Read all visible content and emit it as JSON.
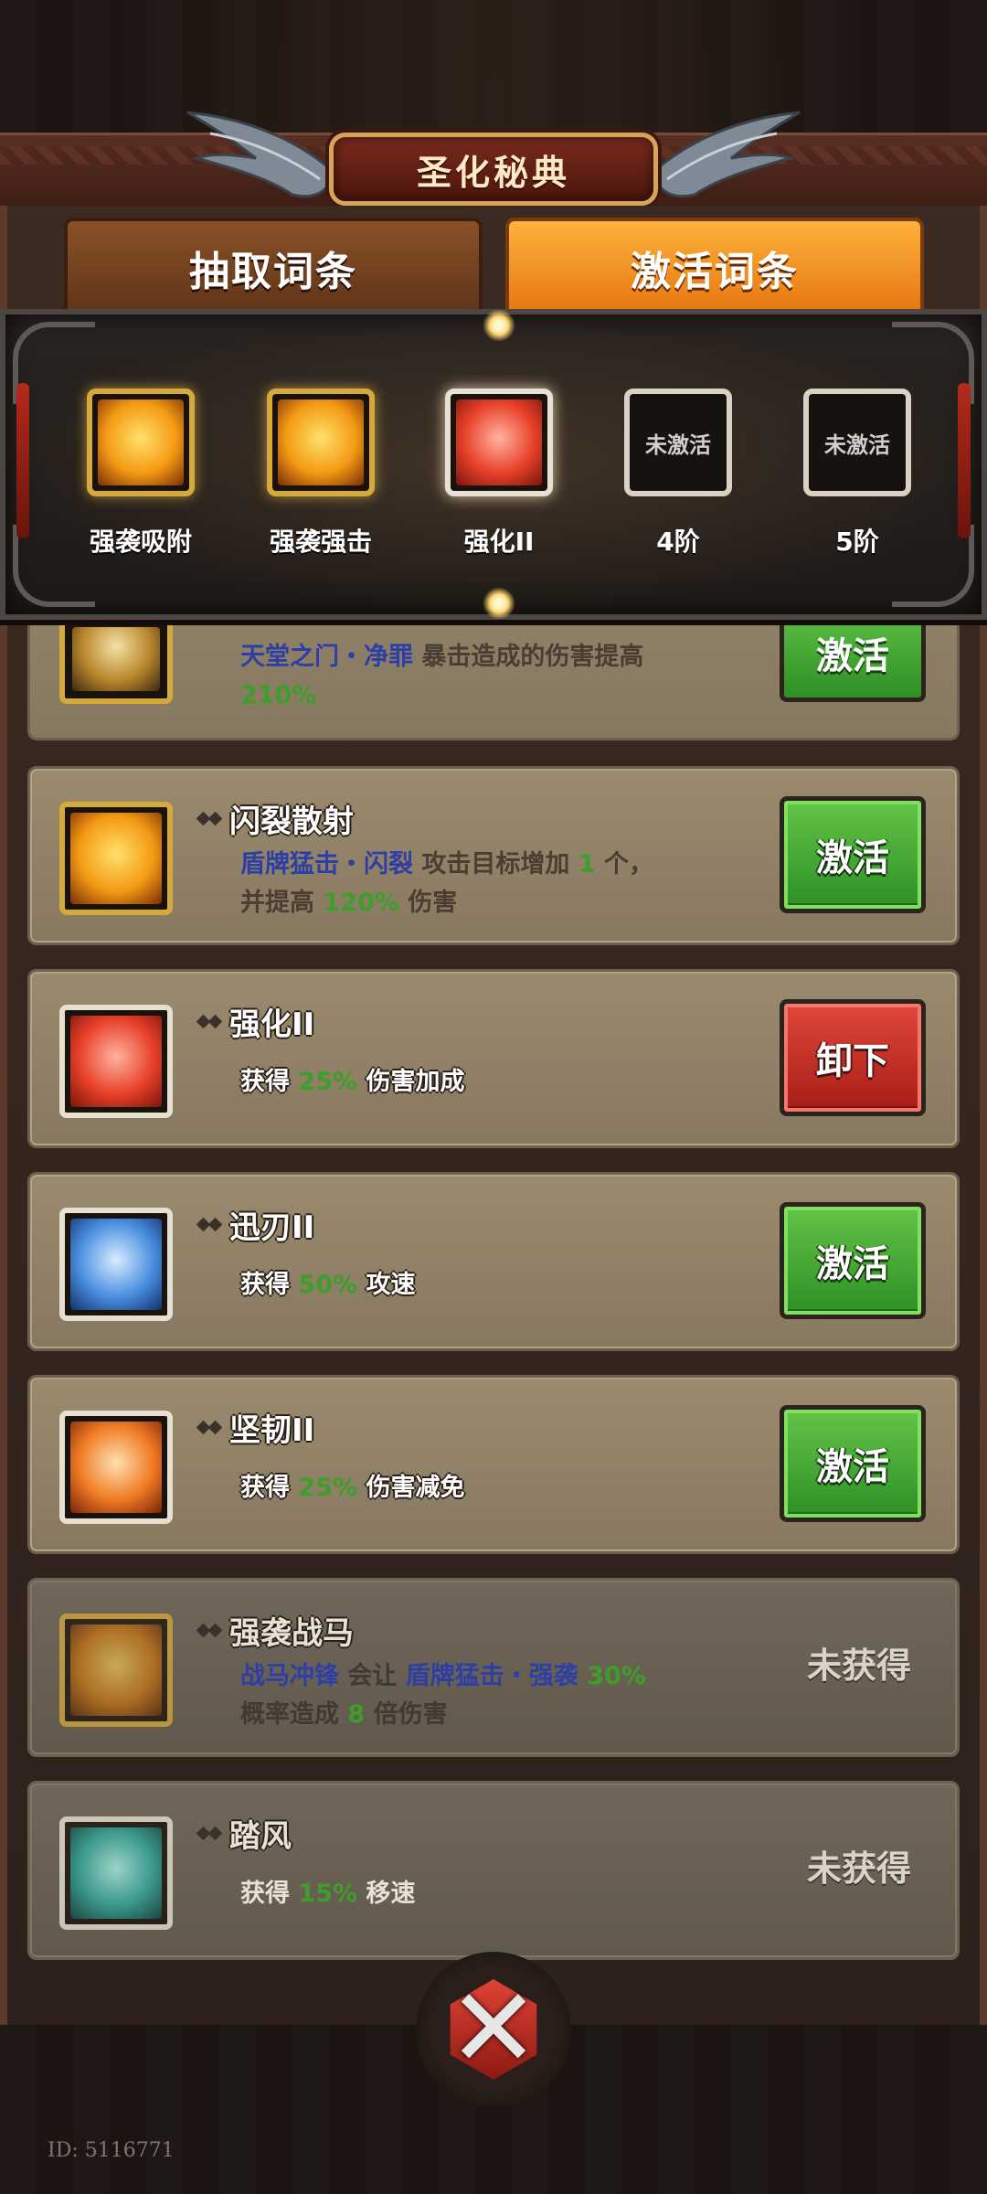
{
  "header": {
    "title": "圣化秘典"
  },
  "tabs": [
    {
      "label": "抽取词条",
      "active": false
    },
    {
      "label": "激活词条",
      "active": true
    }
  ],
  "slots": [
    {
      "label": "强袭吸附",
      "state": "gold"
    },
    {
      "label": "强袭强击",
      "state": "gold"
    },
    {
      "label": "强化II",
      "state": "red"
    },
    {
      "label": "4阶",
      "state": "locked",
      "text": "未激活"
    },
    {
      "label": "5阶",
      "state": "locked",
      "text": "未激活"
    }
  ],
  "partial_entry": {
    "skill": "天堂之门・净罪",
    "desc": "暴击造成的伤害提高",
    "value": "210%",
    "button": "激活"
  },
  "entries": [
    {
      "title": "闪裂散射",
      "skill": "盾牌猛击・闪裂",
      "desc_a": "攻击目标增加",
      "num_a": "1",
      "desc_b": "个，",
      "desc_c": "并提高",
      "num_b": "120%",
      "desc_d": "伤害",
      "button": "激活"
    },
    {
      "title": "强化II",
      "desc_a": "获得",
      "num_a": "25%",
      "desc_b": "伤害加成",
      "button": "卸下"
    },
    {
      "title": "迅刃II",
      "desc_a": "获得",
      "num_a": "50%",
      "desc_b": "攻速",
      "button": "激活"
    },
    {
      "title": "坚韧II",
      "desc_a": "获得",
      "num_a": "25%",
      "desc_b": "伤害减免",
      "button": "激活"
    },
    {
      "title": "强袭战马",
      "skill_a": "战马冲锋",
      "desc_a": "会让",
      "skill_b": "盾牌猛击・强袭",
      "num_a": "30%",
      "desc_b": "概率造成",
      "num_b": "8",
      "desc_c": "倍伤害",
      "status": "未获得"
    },
    {
      "title": "踏风",
      "desc_a": "获得",
      "num_a": "15%",
      "desc_b": "移速",
      "status": "未获得"
    }
  ],
  "footer": {
    "uid": "ID: 5116771"
  },
  "colors": {
    "accent_orange": "#f49a14",
    "button_green": "#2d8f25",
    "button_red": "#a71d17",
    "skill_blue": "#2d3fa5",
    "number_green": "#3f9e2a"
  }
}
